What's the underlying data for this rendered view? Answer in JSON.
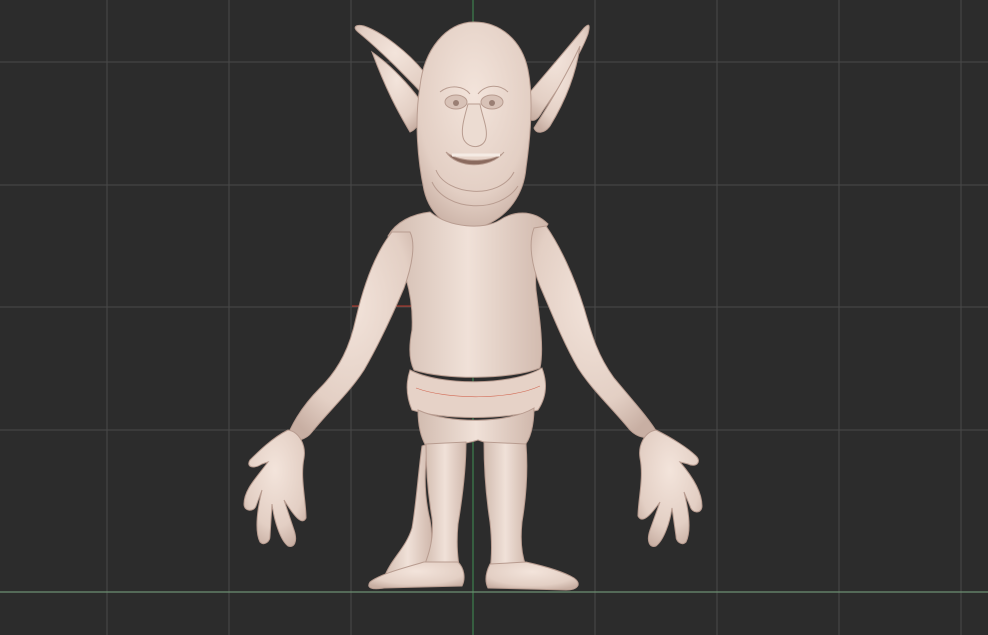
{
  "viewport": {
    "mode": "front-orthographic",
    "background_color": "#2c2c2c",
    "grid": {
      "visible": true,
      "line_color": "#4a4a4a",
      "horizon_color": "#6d8f72"
    },
    "axes": {
      "x_axis_color": "#c0392b",
      "z_axis_color": "#27ae60"
    }
  },
  "model": {
    "subject": "goblin-sculpt",
    "pose": "A-pose",
    "material_color": "#e8d6cc",
    "shadow_color": "#b89c90",
    "wireframe_accent": "#d26a55"
  }
}
